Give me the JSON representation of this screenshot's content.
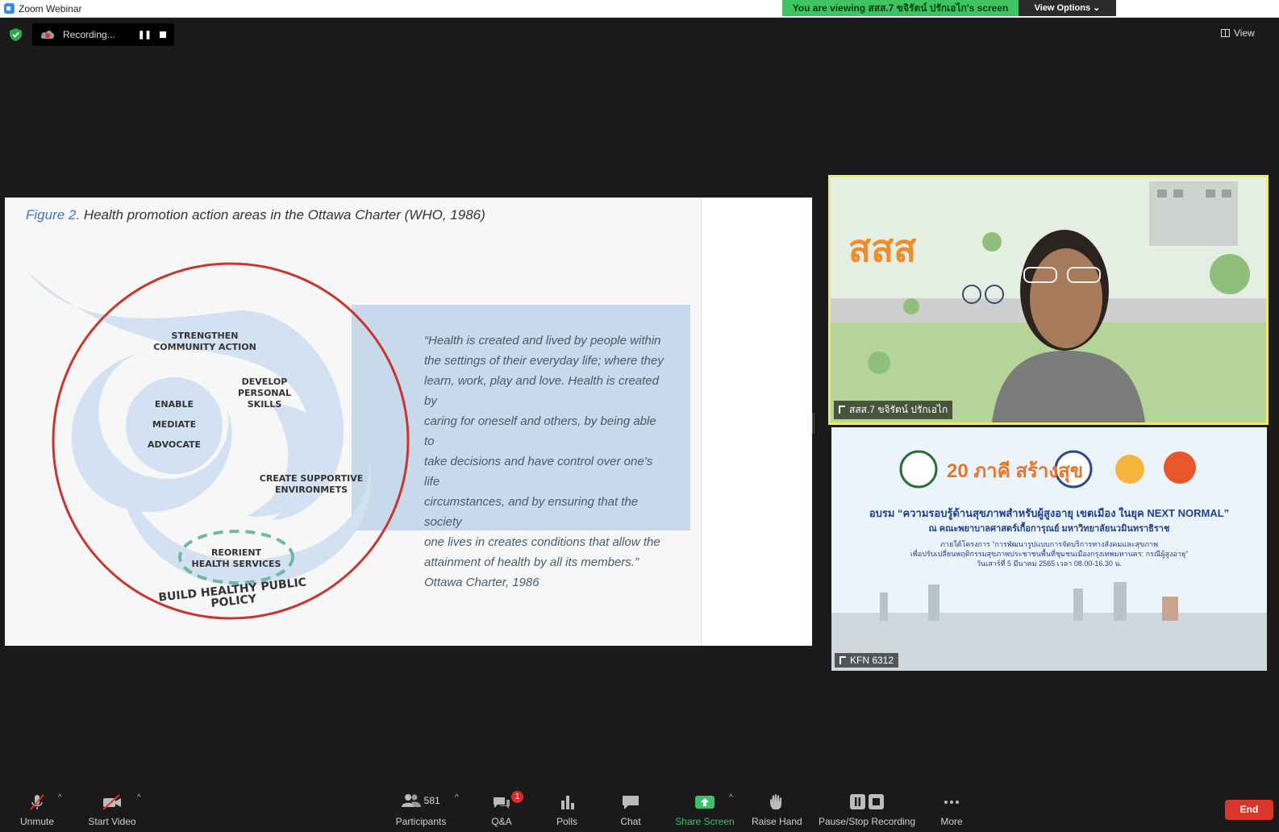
{
  "window": {
    "title": "Zoom Webinar"
  },
  "banner": {
    "viewing_text": "You are viewing สสส.7 ขจิรัตน์ ปรักเอไก's screen",
    "view_options": "View Options ⌄"
  },
  "recording": {
    "status": "Recording...",
    "pause_glyph": "❚❚"
  },
  "view_button": "View",
  "slide": {
    "figure_number": "Figure 2.",
    "figure_title": " Health promotion action areas in the Ottawa Charter (WHO, 1986)",
    "quote_lines": [
      "“Health is created and lived by people within",
      "the settings of their everyday life; where they",
      "learn, work, play and love. Health is created by",
      "caring for oneself and others, by being able to",
      "take decisions and have control over one’s life",
      "circumstances, and by ensuring that the society",
      "one lives in creates conditions that allow the",
      "attainment of health by all its members.”",
      "Ottawa Charter, 1986"
    ],
    "labels": {
      "strengthen": "STRENGTHEN\nCOMMUNITY ACTION",
      "develop": "DEVELOP\nPERSONAL\nSKILLS",
      "enable": "ENABLE",
      "mediate": "MEDIATE",
      "advocate": "ADVOCATE",
      "supportive": "CREATE SUPPORTIVE\nENVIRONMETS",
      "reorient": "REORIENT\nHEALTH SERVICES",
      "policy": "BUILD HEALTHY PUBLIC POLICY"
    }
  },
  "tiles": {
    "speaker_name": "สสส.7 ขจิรัตน์ ปรักเอไก",
    "speaker_logo": "สสส",
    "banner_name": "KFN 6312",
    "banner_title": "อบรม “ความรอบรู้ด้านสุขภาพสำหรับผู้สูงอายุ เขตเมือง ในยุค NEXT NORMAL”",
    "banner_sub": "ณ คณะพยาบาลศาสตร์เกื้อการุณย์ มหาวิทยาลัยนวมินทราธิราช",
    "banner_line1": "ภายใต้โครงการ “การพัฒนารูปแบบการจัดบริการทางสังคมและสุขภาพ",
    "banner_line2": "เพื่อปรับเปลี่ยนพฤติกรรมสุขภาพประชาชนพื้นที่ชุมชนเมืองกรุงเทพมหานคร: กรณีผู้สูงอายุ”",
    "banner_line3": "วันเสาร์ที่ 5 มีนาคม 2565 เวลา 08.00-16.30 น.",
    "banner_badge": "20 ภาคี สร้างสุข"
  },
  "toolbar": {
    "unmute": "Unmute",
    "start_video": "Start Video",
    "participants": "Participants",
    "participants_count": "581",
    "qa": "Q&A",
    "qa_badge": "1",
    "polls": "Polls",
    "chat": "Chat",
    "share_screen": "Share Screen",
    "raise_hand": "Raise Hand",
    "pause_stop": "Pause/Stop Recording",
    "more": "More",
    "end": "End",
    "caret": "^"
  },
  "colors": {
    "accent_green": "#40c463",
    "end_red": "#d9362b",
    "circle_red": "#c8372d",
    "slide_blue": "#c8d9ec",
    "highlight_yellow": "#f1e96e"
  }
}
